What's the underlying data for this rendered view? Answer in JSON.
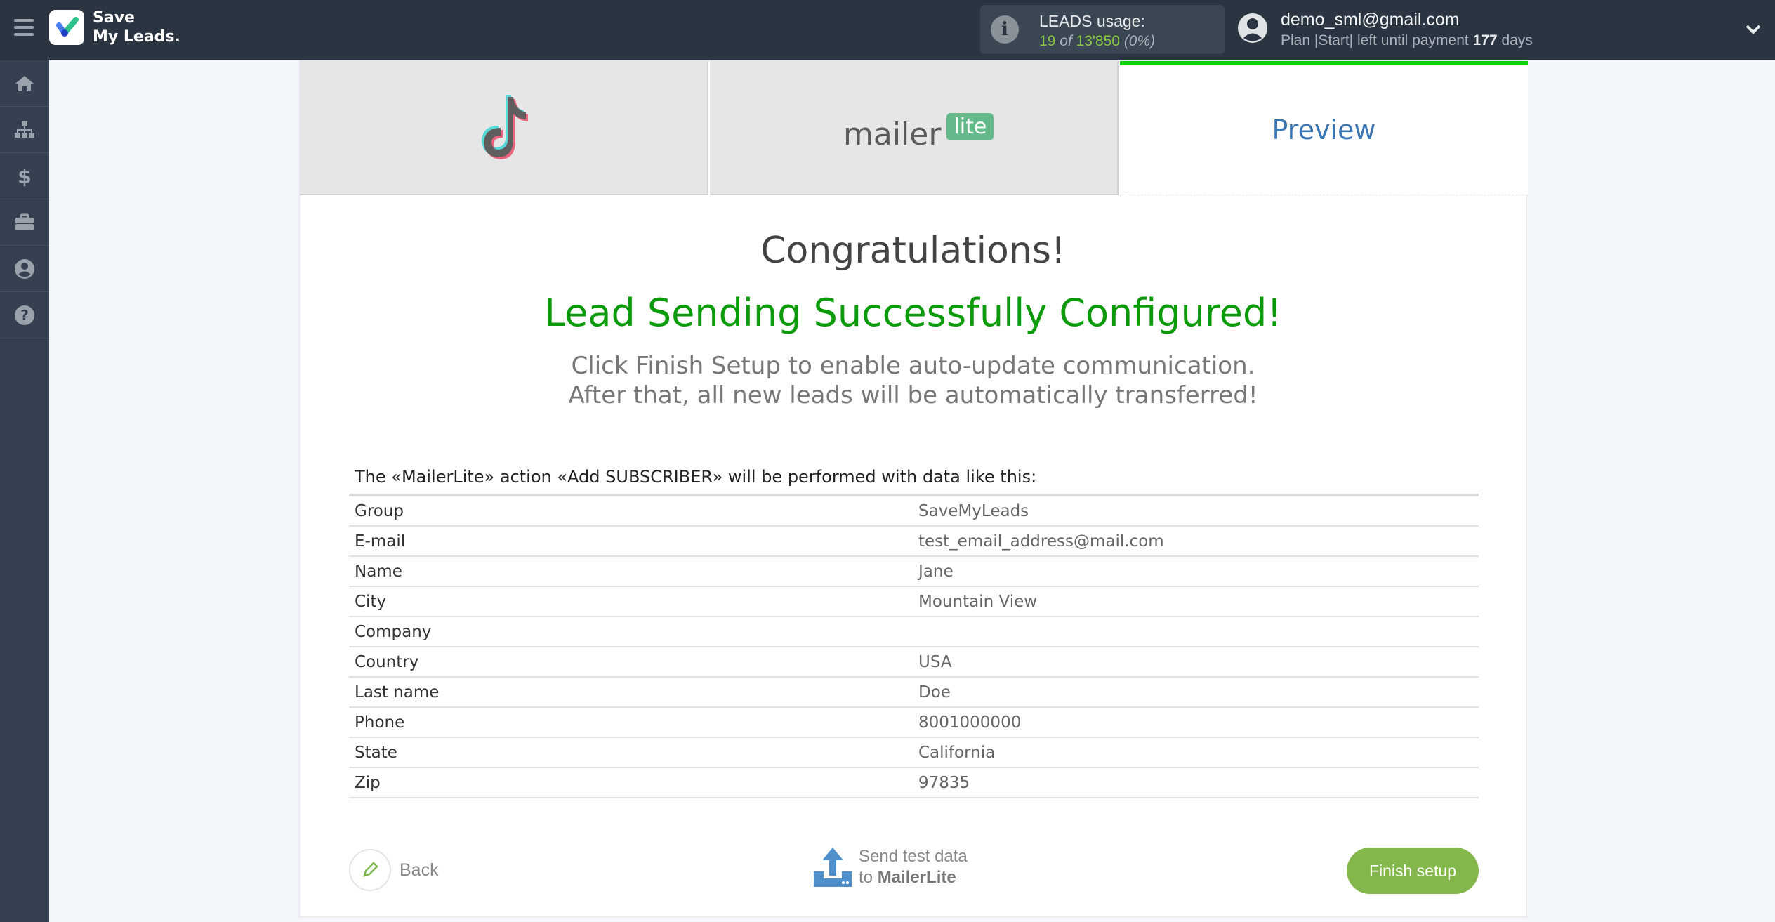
{
  "app": {
    "logo_line1": "Save",
    "logo_line2": "My Leads."
  },
  "header": {
    "leads_title": "LEADS usage:",
    "leads_used": "19",
    "leads_of": "of",
    "leads_total": "13'850",
    "leads_pct": "(0%)",
    "user_email": "demo_sml@gmail.com",
    "plan_prefix": "Plan |Start| left until payment",
    "plan_days": "177",
    "plan_suffix": "days"
  },
  "sidebar": {
    "items": [
      "home-icon",
      "sitemap-icon",
      "dollar-icon",
      "briefcase-icon",
      "user-circle-icon",
      "question-circle-icon"
    ]
  },
  "tabs": {
    "source": "TikTok",
    "destination": "mailer lite",
    "preview": "Preview"
  },
  "main": {
    "congrats": "Congratulations!",
    "success": "Lead Sending Successfully Configured!",
    "desc_line1": "Click Finish Setup to enable auto-update communication.",
    "desc_line2": "After that, all new leads will be automatically transferred!",
    "caption": "The «MailerLite» action «Add SUBSCRIBER» will be performed with data like this:",
    "rows": [
      {
        "k": "Group",
        "v": "SaveMyLeads"
      },
      {
        "k": "E-mail",
        "v": "test_email_address@mail.com"
      },
      {
        "k": "Name",
        "v": "Jane"
      },
      {
        "k": "City",
        "v": "Mountain View"
      },
      {
        "k": "Company",
        "v": ""
      },
      {
        "k": "Country",
        "v": "USA"
      },
      {
        "k": "Last name",
        "v": "Doe"
      },
      {
        "k": "Phone",
        "v": "8001000000"
      },
      {
        "k": "State",
        "v": "California"
      },
      {
        "k": "Zip",
        "v": "97835"
      }
    ]
  },
  "actions": {
    "back": "Back",
    "send_line1": "Send test data",
    "send_to": "to",
    "send_target": "MailerLite",
    "finish": "Finish setup"
  },
  "colors": {
    "accent_green": "#07d107",
    "success_text": "#0a9a0a",
    "finish_button": "#84b74b",
    "preview_blue": "#3a76b4"
  }
}
